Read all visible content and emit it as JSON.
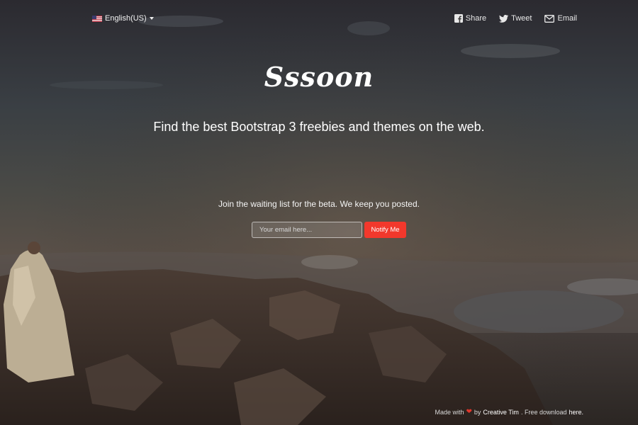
{
  "language": {
    "label": "English(US)",
    "flag_icon": "us-flag-icon"
  },
  "social": {
    "share": {
      "label": "Share",
      "icon": "facebook-icon"
    },
    "tweet": {
      "label": "Tweet",
      "icon": "twitter-icon"
    },
    "email": {
      "label": "Email",
      "icon": "envelope-icon"
    }
  },
  "hero": {
    "logo": "Sssoon",
    "tagline": "Find the best Bootstrap 3 freebies and themes on the web.",
    "waitlist_text": "Join the waiting list for the beta. We keep you posted."
  },
  "form": {
    "email_placeholder": "Your email here...",
    "notify_label": "Notify Me",
    "notify_color": "#f2382c"
  },
  "footer": {
    "made_with": "Made with",
    "by": "by",
    "author": "Creative Tim",
    "free_download": ". Free download",
    "here": "here."
  }
}
